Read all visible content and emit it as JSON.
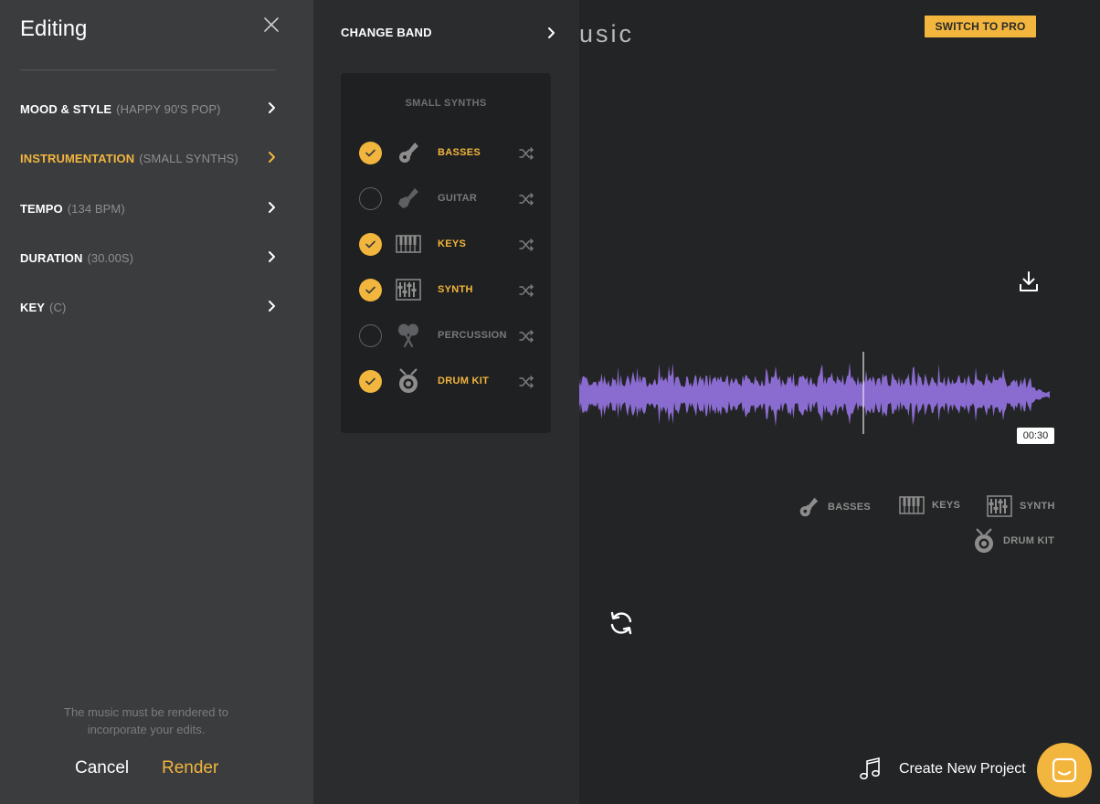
{
  "main": {
    "title": "usic",
    "pro_button": "SWITCH TO PRO",
    "timestamp": "00:30",
    "legend": [
      {
        "label": "BASSES",
        "icon": "guitar-icon"
      },
      {
        "label": "KEYS",
        "icon": "piano-keys-icon"
      },
      {
        "label": "SYNTH",
        "icon": "synth-icon"
      },
      {
        "label": "DRUM KIT",
        "icon": "drum-kit-icon"
      }
    ],
    "create_project": "Create New Project",
    "icons": {
      "download": "download-icon",
      "refresh": "refresh-icon",
      "chat": "chat-icon",
      "music_note": "music-note-icon"
    }
  },
  "editing": {
    "title": "Editing",
    "items": [
      {
        "label": "MOOD & STYLE",
        "value": "(HAPPY 90'S POP)",
        "active": false
      },
      {
        "label": "INSTRUMENTATION",
        "value": "(SMALL SYNTHS)",
        "active": true
      },
      {
        "label": "TEMPO",
        "value": "(134 BPM)",
        "active": false
      },
      {
        "label": "DURATION",
        "value": "(30.00S)",
        "active": false
      },
      {
        "label": "KEY",
        "value": "(C)",
        "active": false
      }
    ],
    "note": "The music must be rendered to incorporate your edits.",
    "cancel": "Cancel",
    "render": "Render"
  },
  "band": {
    "header": "CHANGE BAND",
    "card_title": "SMALL SYNTHS",
    "instruments": [
      {
        "name": "BASSES",
        "checked": true,
        "icon": "guitar-icon"
      },
      {
        "name": "GUITAR",
        "checked": false,
        "icon": "guitar-icon"
      },
      {
        "name": "KEYS",
        "checked": true,
        "icon": "piano-keys-icon"
      },
      {
        "name": "SYNTH",
        "checked": true,
        "icon": "synth-icon"
      },
      {
        "name": "PERCUSSION",
        "checked": false,
        "icon": "maracas-icon"
      },
      {
        "name": "DRUM KIT",
        "checked": true,
        "icon": "drum-kit-icon"
      }
    ]
  },
  "colors": {
    "accent": "#f2b53d",
    "waveform": "#8a6cd1",
    "panel": "#3b3c3e",
    "band_panel": "#2b2c2e",
    "card": "#1f2021",
    "background": "#232425"
  }
}
